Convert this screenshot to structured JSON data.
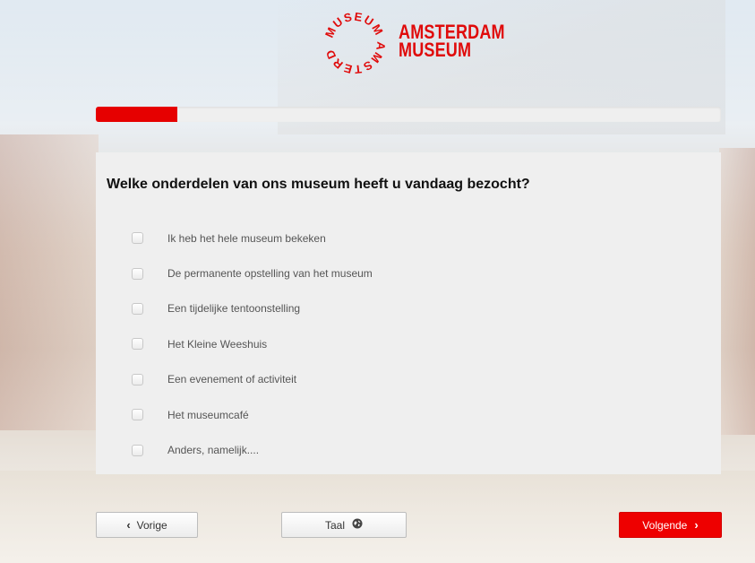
{
  "logo": {
    "seal_text": "MUSEUM AMSTERDAM",
    "line1": "AMSTERDAM",
    "line2": "MUSEUM",
    "color": "#e00b0b"
  },
  "progress": {
    "value_fraction": 0.13,
    "color": "#e60000"
  },
  "survey": {
    "question": "Welke onderdelen van ons museum heeft u vandaag bezocht?",
    "options": [
      "Ik heb het hele museum bekeken",
      "De permanente opstelling van het museum",
      "Een tijdelijke tentoonstelling",
      "Het Kleine Weeshuis",
      "Een evenement of activiteit",
      "Het museumcafé",
      "Anders, namelijk...."
    ]
  },
  "nav": {
    "prev_label": "Vorige",
    "prev_icon": "chevron-left-icon",
    "lang_label": "Taal",
    "lang_icon": "globe-icon",
    "next_label": "Volgende",
    "next_icon": "chevron-right-icon",
    "next_color": "#ee0000"
  }
}
